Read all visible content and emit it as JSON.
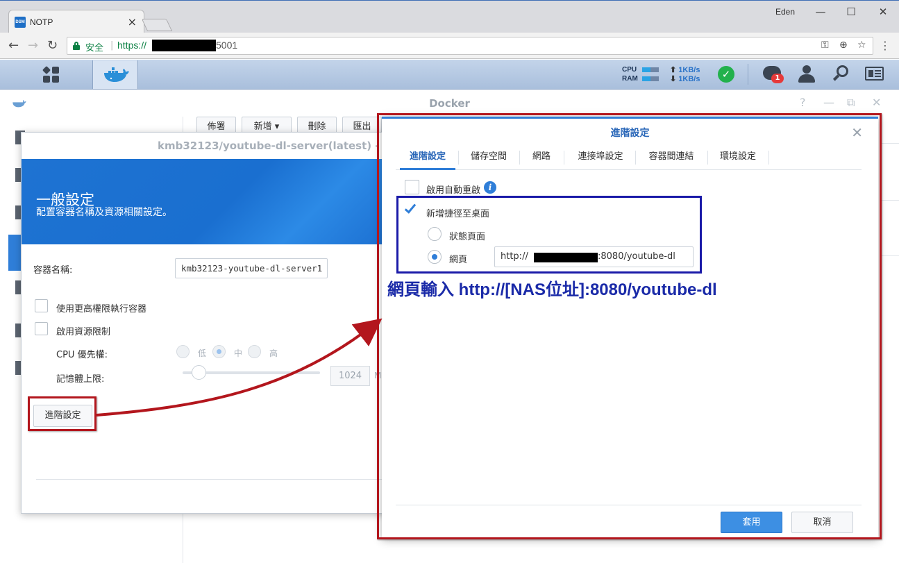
{
  "browser": {
    "tab_title": "NOTP",
    "favicon_text": "DSM",
    "tab_close": "×",
    "user": "Eden",
    "minimize": "—",
    "maximize": "☐",
    "close": "✕",
    "secure_label": "安全",
    "url_scheme": "https://",
    "url_suffix": "5001"
  },
  "dsm": {
    "cpu_label": "CPU",
    "ram_label": "RAM",
    "upload_rate": "1KB/s",
    "download_rate": "1KB/s",
    "notification_count": "1",
    "cpu_usage": 0.5,
    "ram_usage": 0.5
  },
  "docker": {
    "title": "Docker",
    "toolbar": [
      "佈署",
      "新增 ▾",
      "刪除",
      "匯出"
    ]
  },
  "general_dialog": {
    "window_title": "kmb32123/youtube-dl-server(latest) -",
    "heading": "一般設定",
    "subheading": "配置容器名稱及資源相關設定。",
    "container_name_label": "容器名稱:",
    "container_name_value": "kmb32123-youtube-dl-server1",
    "high_privilege_label": "使用更高權限執行容器",
    "resource_limit_label": "啟用資源限制",
    "cpu_priority_label": "CPU 優先權:",
    "cpu_low": "低",
    "cpu_mid": "中",
    "cpu_high": "高",
    "memory_limit_label": "記憶體上限:",
    "memory_value": "1024",
    "memory_unit": "M",
    "advanced_button": "進階設定"
  },
  "advanced_dialog": {
    "title": "進階設定",
    "close": "✕",
    "tabs": [
      "進階設定",
      "儲存空間",
      "網路",
      "連接埠設定",
      "容器間連結",
      "環境設定"
    ],
    "auto_restart_label": "啟用自動重啟",
    "shortcut_label": "新增捷徑至桌面",
    "status_page_label": "狀態頁面",
    "webpage_label": "網頁",
    "webpage_url_prefix": "http://",
    "webpage_url_suffix": ":8080/youtube-dl",
    "apply_button": "套用",
    "cancel_button": "取消"
  },
  "annotation": {
    "text": "網頁輸入 http://[NAS位址]:8080/youtube-dl",
    "colors": {
      "red": "#b3161d",
      "blue": "#1a1aa8"
    }
  }
}
